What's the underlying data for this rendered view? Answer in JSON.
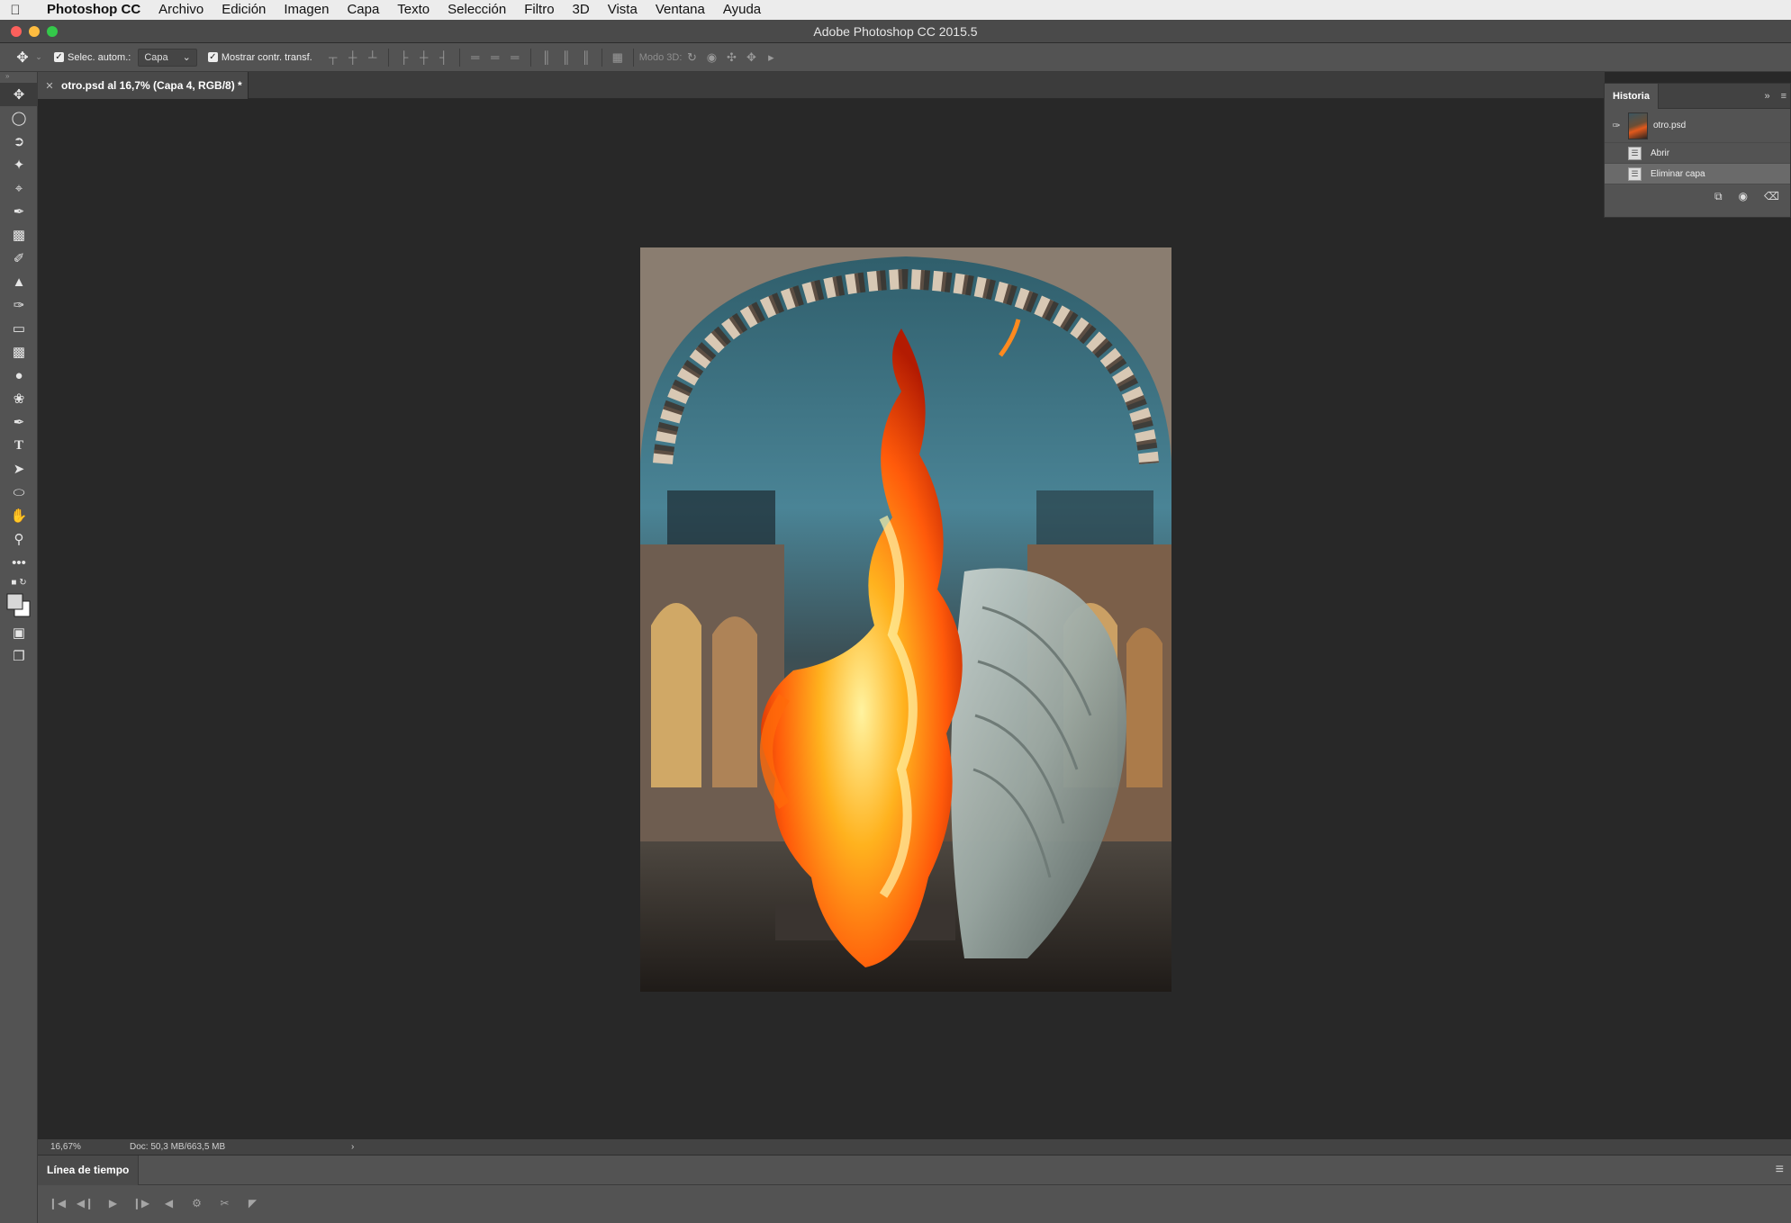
{
  "menubar": {
    "apple_icon": "apple-icon",
    "app_name": "Photoshop CC",
    "items": [
      "Archivo",
      "Edición",
      "Imagen",
      "Capa",
      "Texto",
      "Selección",
      "Filtro",
      "3D",
      "Vista",
      "Ventana",
      "Ayuda"
    ]
  },
  "window": {
    "title": "Adobe Photoshop CC 2015.5",
    "traffic_colors": [
      "#fc605c",
      "#fdbc40",
      "#34c84a"
    ]
  },
  "options_bar": {
    "auto_select_label": "Selec. autom.:",
    "auto_select_checked": true,
    "auto_select_value": "Capa",
    "show_transform_label": "Mostrar contr. transf.",
    "show_transform_checked": true,
    "mode3d_label": "Modo 3D:"
  },
  "toolbar": {
    "tools": [
      "move-tool",
      "marquee-tool",
      "lasso-tool",
      "magic-wand-tool",
      "crop-tool",
      "eyedropper-tool",
      "patch-tool",
      "brush-tool",
      "stamp-tool",
      "history-brush-tool",
      "eraser-tool",
      "gradient-tool",
      "blur-tool",
      "sponge-tool",
      "pen-tool",
      "type-tool",
      "path-selection-tool",
      "ellipse-tool",
      "hand-tool",
      "zoom-tool",
      "more-tools"
    ]
  },
  "document": {
    "tab_title": "otro.psd al 16,7% (Capa 4, RGB/8) *"
  },
  "status": {
    "zoom": "16,67%",
    "doc_size": "Doc: 50,3 MB/663,5 MB"
  },
  "timeline": {
    "tab_label": "Línea de tiempo"
  },
  "history_panel": {
    "tab_label": "Historia",
    "snapshot_name": "otro.psd",
    "states": [
      {
        "label": "Abrir",
        "selected": false
      },
      {
        "label": "Eliminar capa",
        "selected": true
      }
    ]
  },
  "colors": {
    "accent_fire": "#ff7a10",
    "workspace_bg": "#282828",
    "panel_bg": "#535353"
  }
}
